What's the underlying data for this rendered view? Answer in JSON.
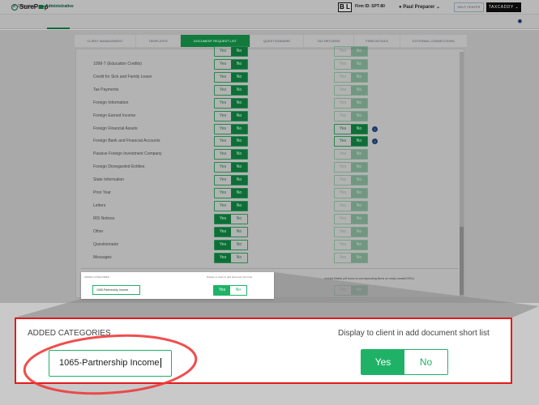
{
  "header": {
    "logo": "SurePrep",
    "firm_badge": "B L",
    "firm_id": "Firm ID: SPT-80",
    "user": "Paul Preparer",
    "help": "HELP CENTER",
    "taxcaddy": "TAXCADDY"
  },
  "subnav": {
    "overview": "Overview",
    "administrative": "Administrative"
  },
  "tabs": [
    "CLIENT MANAGEMENT",
    "TEMPLATES",
    "DOCUMENT REQUEST LIST",
    "QUESTIONNAIRE",
    "TAX RETURNS",
    "FIRM DETAILS",
    "EXTERNAL CONNECTIONS"
  ],
  "toggle": {
    "yes": "Yes",
    "no": "No"
  },
  "rows": [
    {
      "label": "1098-T (Education Credits)",
      "value": "No",
      "right_active": false
    },
    {
      "label": "Credit for Sick and Family Leave",
      "value": "No",
      "right_active": false
    },
    {
      "label": "Tax Payments",
      "value": "No",
      "right_active": false
    },
    {
      "label": "Foreign Information",
      "value": "No",
      "right_active": false
    },
    {
      "label": "Foreign Earned Income",
      "value": "No",
      "right_active": false
    },
    {
      "label": "Foreign Financial Assets",
      "value": "No",
      "right_active": true
    },
    {
      "label": "Foreign Bank and Financial Accounts",
      "value": "No",
      "right_active": true
    },
    {
      "label": "Passive Foreign Investment Company",
      "value": "No",
      "right_active": false
    },
    {
      "label": "Foreign Disregarded Entities",
      "value": "No",
      "right_active": false
    },
    {
      "label": "State Information",
      "value": "No",
      "right_active": false
    },
    {
      "label": "Prior Year",
      "value": "No",
      "right_active": false
    },
    {
      "label": "Letters",
      "value": "No",
      "right_active": false
    },
    {
      "label": "IRS Notices",
      "value": "Yes",
      "right_active": false
    },
    {
      "label": "Other",
      "value": "Yes",
      "right_active": false
    },
    {
      "label": "Questionnaire",
      "value": "Yes",
      "right_active": false
    },
    {
      "label": "Messages",
      "value": "Yes",
      "right_active": false
    }
  ],
  "added": {
    "title": "ADDED CATEGORIES",
    "display_label": "Display to client in add document short list",
    "input_value": "1065-Partnership Income",
    "value": "Yes"
  },
  "fillable": {
    "label": "Include fillable pdf forms to corresponding items on newly created DRLs"
  },
  "colors": {
    "accent": "#1fb267",
    "highlight": "#e21b1b"
  }
}
